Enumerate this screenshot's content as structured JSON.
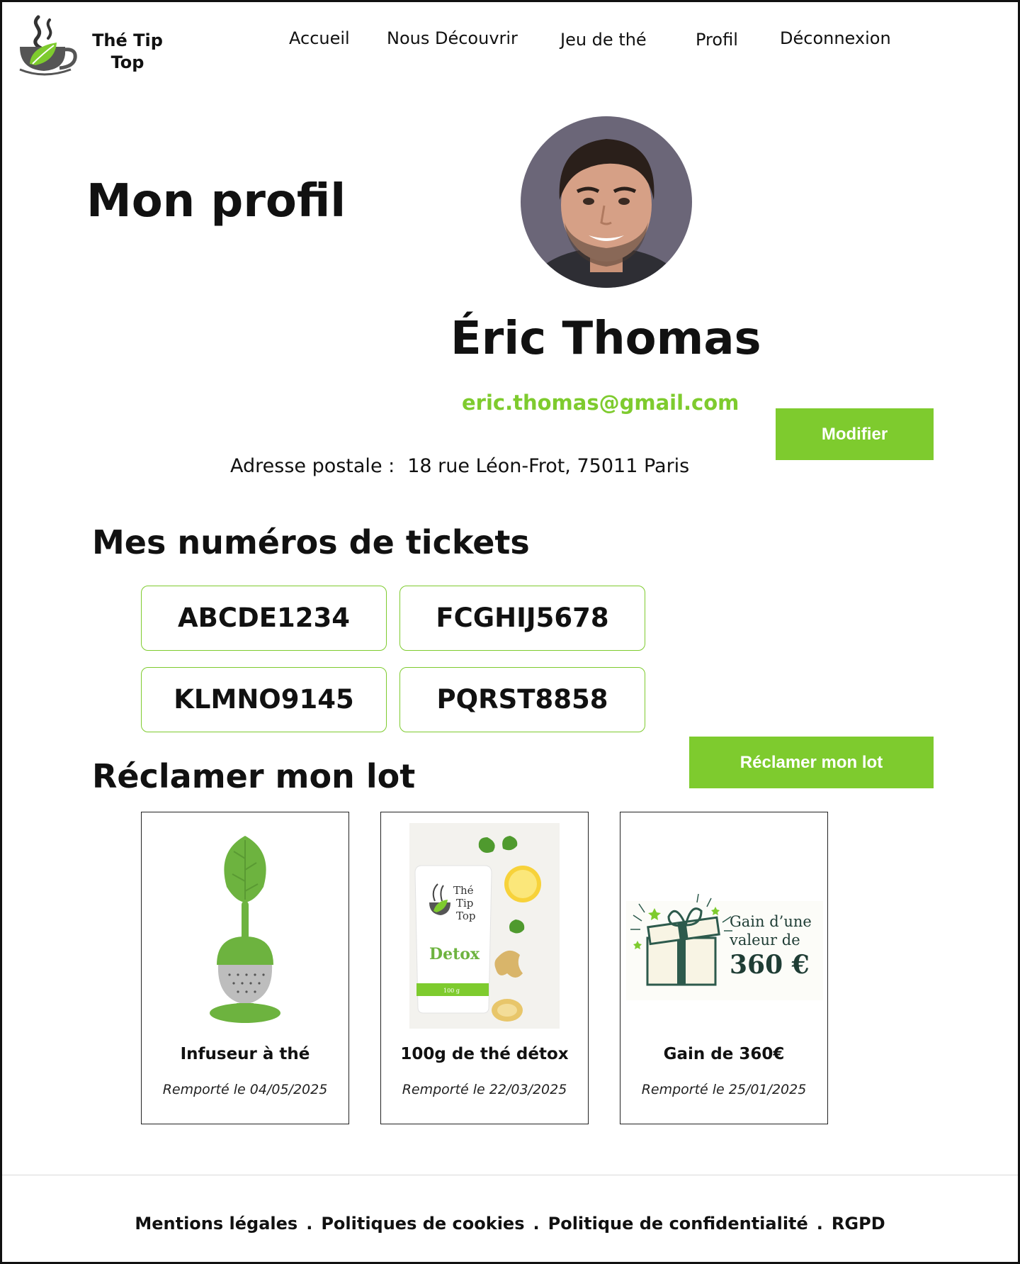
{
  "brand": {
    "name": "Thé Tip Top"
  },
  "nav": {
    "items": [
      {
        "label": "Accueil"
      },
      {
        "label": "Nous Découvrir"
      },
      {
        "label": "Jeu de thé"
      },
      {
        "label": "Profil"
      },
      {
        "label": "Déconnexion"
      }
    ]
  },
  "profile": {
    "title": "Mon profil",
    "name": "Éric Thomas",
    "email": "eric.thomas@gmail.com",
    "address_label": "Adresse postale :",
    "address_value": "18 rue Léon-Frot, 75011 Paris",
    "modify_label": "Modifier"
  },
  "tickets": {
    "title": "Mes numéros de tickets",
    "items": [
      "ABCDE1234",
      "FCGHIJ5678",
      "KLMNO9145",
      "PQRST8858"
    ]
  },
  "prizes": {
    "title": "Réclamer mon lot",
    "claim_label": "Réclamer mon lot",
    "items": [
      {
        "name": "Infuseur à thé",
        "date": "Remporté le 04/05/2025"
      },
      {
        "name": "100g de thé détox",
        "date": "Remporté le 22/03/2025",
        "pack_brand_lines": [
          "Thé",
          "Tip",
          "Top"
        ],
        "pack_label": "Detox",
        "pack_weight": "100 g"
      },
      {
        "name": "Gain de 360€",
        "date": "Remporté le 25/01/2025",
        "image_lines": [
          "Gain d’une",
          "valeur de"
        ],
        "image_amount": "360 €"
      }
    ]
  },
  "footer": {
    "links": [
      {
        "label": "Mentions légales"
      },
      {
        "label": "Politiques de cookies"
      },
      {
        "label": "Politique de confidentialité"
      },
      {
        "label": "RGPD"
      }
    ],
    "separator": "."
  },
  "colors": {
    "accent_green": "#7ecb2e",
    "text_dark": "#111111",
    "card_border": "#222222"
  }
}
